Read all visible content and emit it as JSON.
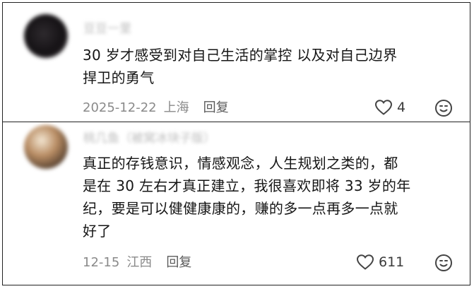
{
  "comments": [
    {
      "username": "豆豆一里",
      "body_lines": [
        "30 岁才感受到对自己生活的掌控 以及对自己边界",
        "捍卫的勇气"
      ],
      "date": "2025-12-22",
      "location": "上海",
      "reply_label": "回复",
      "likes": "4"
    },
    {
      "username": "桃几鱼（被窝冰块子版）",
      "body_lines": [
        "真正的存钱意识，情感观念，人生规划之类的，都",
        "是在 30 左右才真正建立，我很喜欢即将 33 岁的年",
        "纪，要是可以健健康康的，赚的多一点再多一点就",
        "好了"
      ],
      "date": "12-15",
      "location": "江西",
      "reply_label": "回复",
      "likes": "611"
    }
  ],
  "icons": {
    "like": "heart-outline-icon",
    "reaction": "emoji-face-icon"
  },
  "colors": {
    "border": "#222222",
    "meta": "#8a8a8a",
    "text": "#151515"
  }
}
